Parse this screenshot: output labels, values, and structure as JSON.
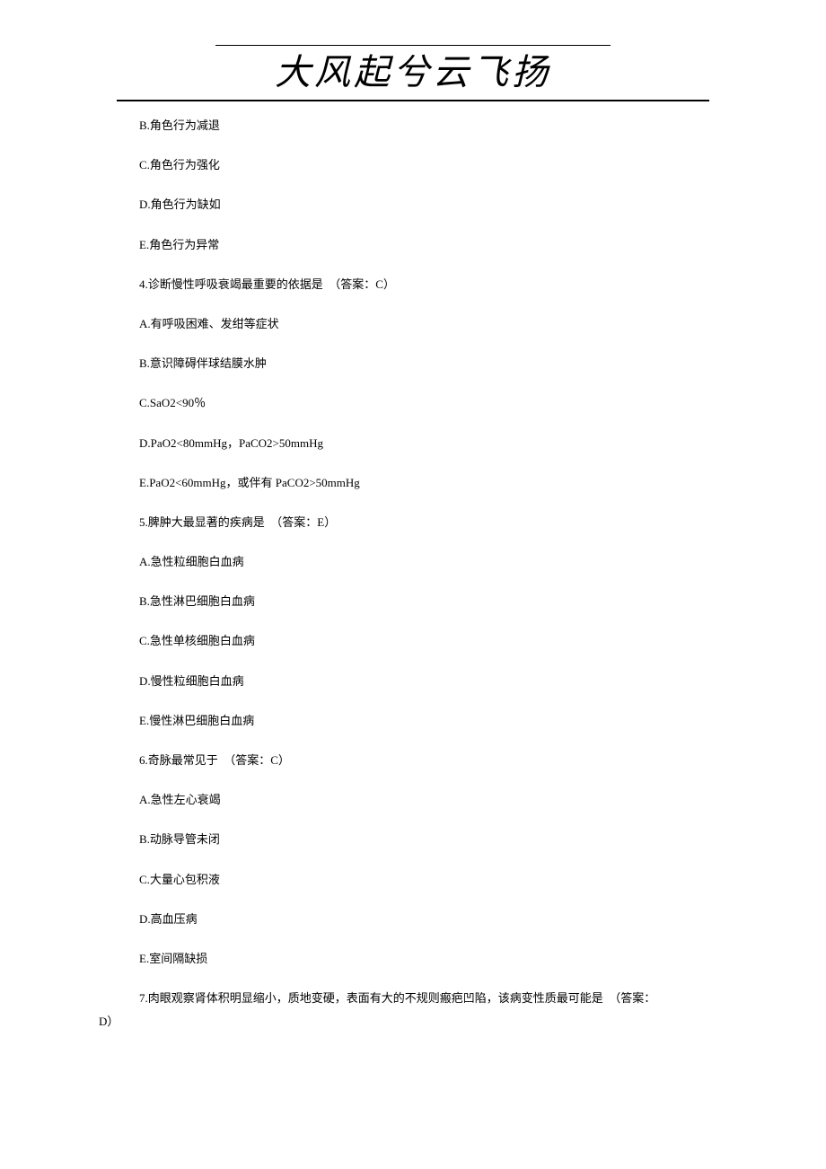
{
  "header": {
    "title": "大风起兮云飞扬"
  },
  "lines": {
    "q3": {
      "b": "B.角色行为减退",
      "c": "C.角色行为强化",
      "d": "D.角色行为缺如",
      "e": "E.角色行为异常"
    },
    "q4": {
      "stem": "4.诊断慢性呼吸衰竭最重要的依据是  （答案：C）",
      "a": "A.有呼吸困难、发绀等症状",
      "b": "B.意识障碍伴球结膜水肿",
      "c": "C.SaO2<90％",
      "d": "D.PaO2<80mmHg，PaCO2>50mmHg",
      "e": "E.PaO2<60mmHg，或伴有 PaCO2>50mmHg"
    },
    "q5": {
      "stem": "5.脾肿大最显著的疾病是  （答案：E）",
      "a": "A.急性粒细胞白血病",
      "b": "B.急性淋巴细胞白血病",
      "c": "C.急性单核细胞白血病",
      "d": "D.慢性粒细胞白血病",
      "e": "E.慢性淋巴细胞白血病"
    },
    "q6": {
      "stem": "6.奇脉最常见于  （答案：C）",
      "a": "A.急性左心衰竭",
      "b": "B.动脉导管未闭",
      "c": "C.大量心包积液",
      "d": "D.高血压病",
      "e": "E.室间隔缺损"
    },
    "q7": {
      "stem_l1": "7.肉眼观察肾体积明显缩小，质地变硬，表面有大的不规则瘢疤凹陷，该病变性质最可能是  （答案：",
      "stem_l2": "D）"
    }
  }
}
